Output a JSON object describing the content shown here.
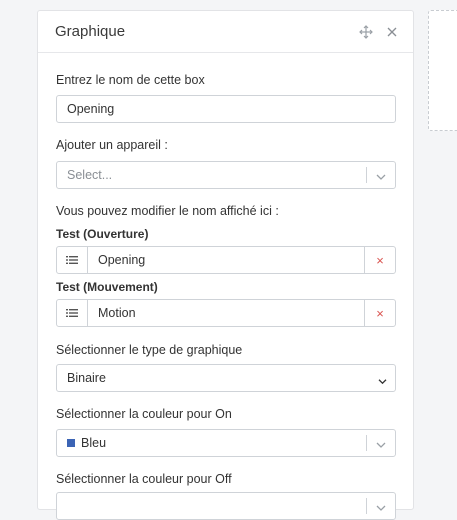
{
  "panel": {
    "title": "Graphique",
    "name_label": "Entrez le nom de cette box",
    "name_value": "Opening",
    "device_label": "Ajouter un appareil :",
    "device_placeholder": "Select...",
    "rename_label": "Vous pouvez modifier le nom affiché ici :",
    "devices": [
      {
        "title": "Test (Ouverture)",
        "value": "Opening",
        "remove": "×"
      },
      {
        "title": "Test (Mouvement)",
        "value": "Motion",
        "remove": "×"
      }
    ],
    "chart_type_label": "Sélectionner le type de graphique",
    "chart_type_value": "Binaire",
    "color_on_label": "Sélectionner la couleur pour On",
    "color_on_value": "Bleu",
    "color_on_hex": "#3b64b5",
    "color_off_label": "Sélectionner la couleur pour Off"
  }
}
